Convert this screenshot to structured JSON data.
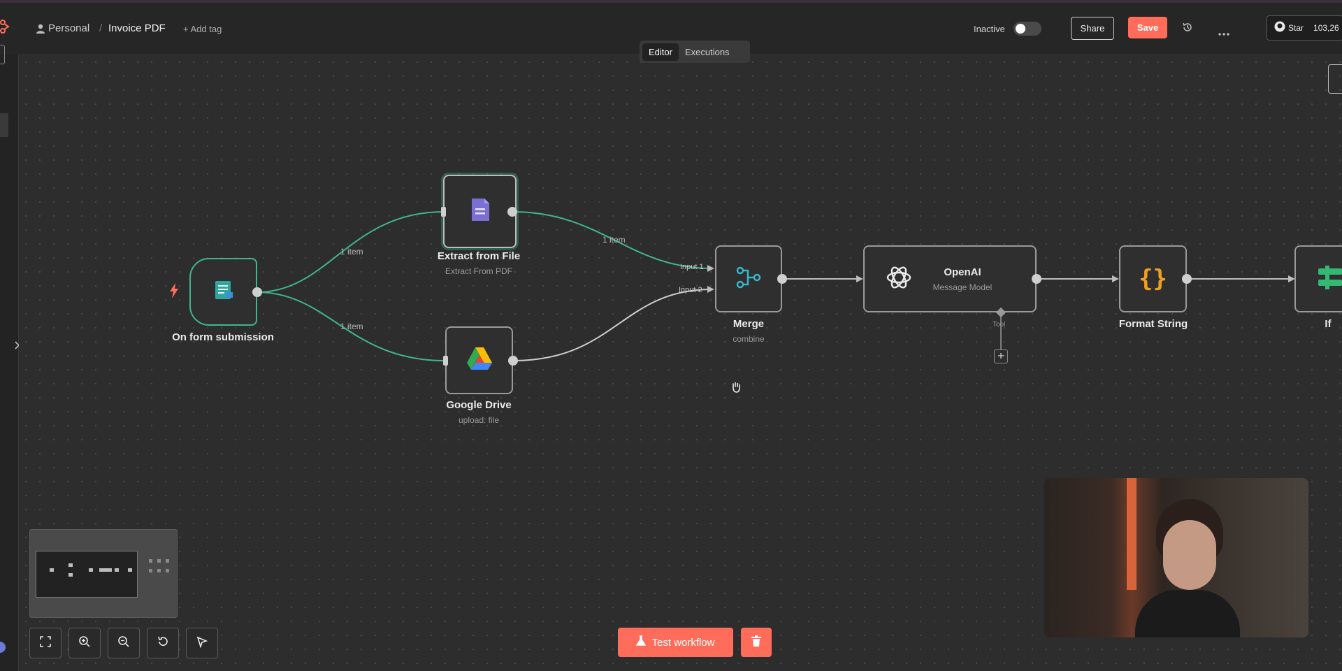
{
  "breadcrumb": {
    "project": "Personal",
    "workflow": "Invoice PDF",
    "add_tag": "+ Add tag"
  },
  "status": {
    "label": "Inactive",
    "active": false
  },
  "header": {
    "share": "Share",
    "save": "Save"
  },
  "github": {
    "star_label": "Star",
    "star_count": "103,26"
  },
  "tabs": [
    {
      "label": "Editor",
      "active": true
    },
    {
      "label": "Executions",
      "active": false
    }
  ],
  "nodes": {
    "trigger": {
      "label": "On form submission"
    },
    "extract": {
      "label": "Extract from File",
      "sub": "Extract From PDF"
    },
    "drive": {
      "label": "Google Drive",
      "sub": "upload: file"
    },
    "merge": {
      "label": "Merge",
      "sub": "combine",
      "input1": "Input 1",
      "input2": "Input 2"
    },
    "openai": {
      "title": "OpenAI",
      "sub": "Message Model",
      "port_tool": "Tool"
    },
    "format": {
      "label": "Format String"
    },
    "if": {
      "label": "If"
    }
  },
  "edges": {
    "to_extract": "1 item",
    "to_drive": "1 item",
    "extract_to_merge": "1 item"
  },
  "footer": {
    "test_workflow": "Test workflow"
  },
  "colors": {
    "accent": "#ff6d5a",
    "success": "#3fb68e",
    "canvas": "#2d2d2d"
  }
}
